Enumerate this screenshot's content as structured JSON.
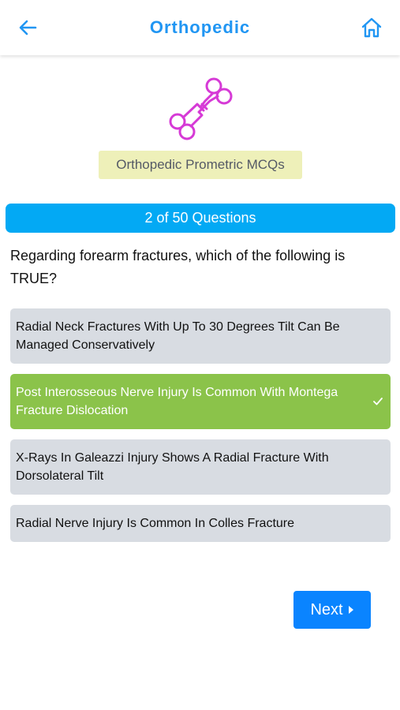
{
  "header": {
    "title": "Orthopedic",
    "back_icon": "arrow-left-icon",
    "home_icon": "home-icon",
    "accent_color": "#2196f3"
  },
  "logo": {
    "icon": "broken-bone-icon",
    "color": "#d63ad6"
  },
  "category_badge": "Orthopedic Prometric MCQs",
  "progress": {
    "text": "2 of 50 Questions",
    "current": 2,
    "total": 50
  },
  "question": "Regarding forearm fractures, which of the following is TRUE?",
  "options": [
    {
      "text": "Radial Neck Fractures With Up To 30 Degrees Tilt Can Be Managed Conservatively",
      "state": "default"
    },
    {
      "text": "Post Interosseous Nerve Injury Is Common With Montega Fracture Dislocation",
      "state": "correct"
    },
    {
      "text": "X-Rays In Galeazzi Injury Shows A Radial Fracture With Dorsolateral Tilt",
      "state": "default"
    },
    {
      "text": "Radial Nerve Injury Is Common In Colles Fracture",
      "state": "default"
    }
  ],
  "next_button": {
    "label": "Next",
    "icon": "caret-right-icon"
  },
  "colors": {
    "correct": "#8bc34a",
    "option_bg": "#d8dce2",
    "progress_bg": "#03a9f4",
    "next_bg": "#0a84ff"
  }
}
